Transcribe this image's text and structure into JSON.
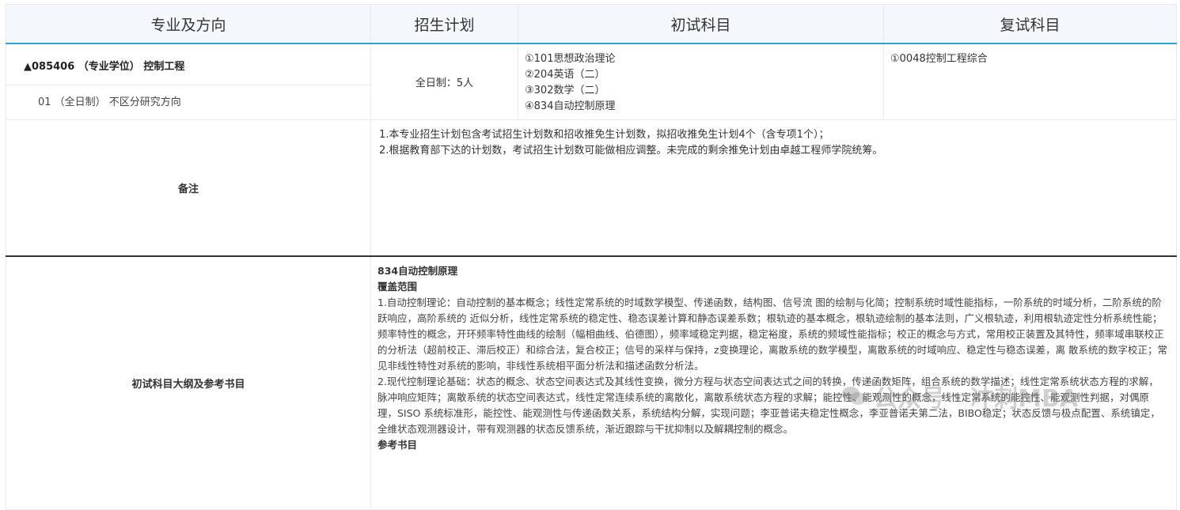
{
  "header": {
    "col_major": "专业及方向",
    "col_plan": "招生计划",
    "col_initial": "初试科目",
    "col_retest": "复试科目"
  },
  "program": {
    "title": "▲085406 （专业学位） 控制工程",
    "direction": "01 （全日制） 不区分研究方向",
    "plan": "全日制：5人",
    "initial_subjects": [
      "①101思想政治理论",
      "②204英语（二）",
      "③302数学（二）",
      "④834自动控制原理"
    ],
    "retest_subjects": [
      "①0048控制工程综合"
    ]
  },
  "notes": {
    "label": "备注",
    "lines": [
      "1.本专业招生计划包含考试招生计划数和招收推免生计划数，拟招收推免生计划4个（含专项1个）；",
      "2.根据教育部下达的计划数，考试招生计划数可能做相应调整。未完成的剩余推免计划由卓越工程师学院统筹。"
    ]
  },
  "outline": {
    "label": "初试科目大纲及参考书目",
    "subject": "834自动控制原理",
    "scope_heading": "覆盖范围",
    "para1": "1.自动控制理论：自动控制的基本概念；线性定常系统的时域数学模型、传递函数，结构图、信号流 图的绘制与化简；控制系统时域性能指标，一阶系统的时域分析，二阶系统的阶跃响应，高阶系统的 近似分析，线性定常系统的稳定性、稳态误差计算和静态误差系数；根轨迹的基本概念，根轨迹绘制的基本法则，广义根轨迹，利用根轨迹定性分析系统性能；频率特性的概念，开环频率特性曲线的绘制（幅相曲线、伯德图），频率域稳定判据，稳定裕度，系统的频域性能指标；校正的概念与方式，常用校正装置及其特性，频率域串联校正的分析法（超前校正、滞后校正）和综合法，复合校正；信号的采样与保持，z变换理论，离散系统的数学模型，离散系统的时域响应、稳定性与稳态误差，离 散系统的数字校正；常见非线性特性对系统的影响，非线性系统相平面分析法和描述函数分析法。",
    "para2": "2.现代控制理论基础：状态的概念、状态空间表达式及其线性变换，微分方程与状态空间表达式之间的转换，传递函数矩阵，组合系统的数学描述；线性定常系统状态方程的求解，脉冲响应矩阵；离散系统的状态空间表达式，线性定常连续系统的离散化，离散系统状态方程的求解；能控性、能观测性的概念，线性定常系统的能控性、能观测性判据，对偶原理，SISO 系统标准形，能控性、能观测性与传递函数关系，系统结构分解，实现问题；李亚普诺夫稳定性概念，李亚普诺夫第二法，BIBO稳定；状态反馈与极点配置、系统镇定，全维状态观测器设计，带有观测器的状态反馈系统，渐近跟踪与干扰抑制以及解耦控制的概念。",
    "reference_heading": "参考书目"
  },
  "watermark": {
    "text": "公众号 · 冲刺MBA"
  }
}
